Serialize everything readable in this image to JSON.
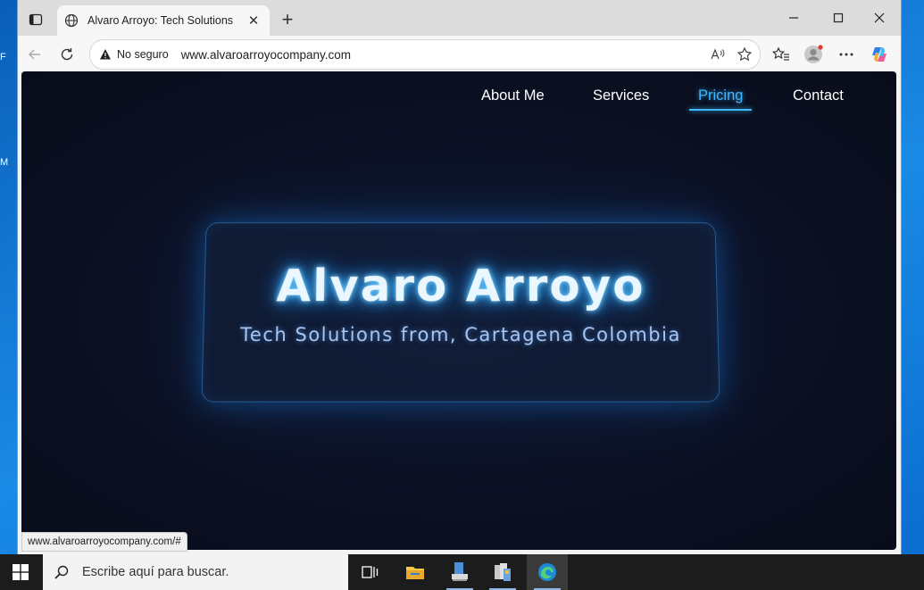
{
  "desktop": {
    "fragments": [
      "F",
      "M"
    ]
  },
  "browser": {
    "tab_title": "Alvaro Arroyo: Tech Solutions",
    "security_label": "No seguro",
    "url": "www.alvaroarroyocompany.com",
    "status_url": "www.alvaroarroyocompany.com/#"
  },
  "site": {
    "nav": [
      "About Me",
      "Services",
      "Pricing",
      "Contact"
    ],
    "active_nav": "Pricing",
    "hero_title": "Alvaro Arroyo",
    "hero_subtitle": "Tech Solutions from, Cartagena Colombia",
    "accent_color": "#3fb8ff",
    "background_color": "#0a0f20"
  },
  "taskbar": {
    "search_placeholder": "Escribe aquí para buscar.",
    "apps": [
      "task-view-icon",
      "file-explorer-icon",
      "network-app-icon",
      "server-manager-icon",
      "edge-icon"
    ]
  }
}
